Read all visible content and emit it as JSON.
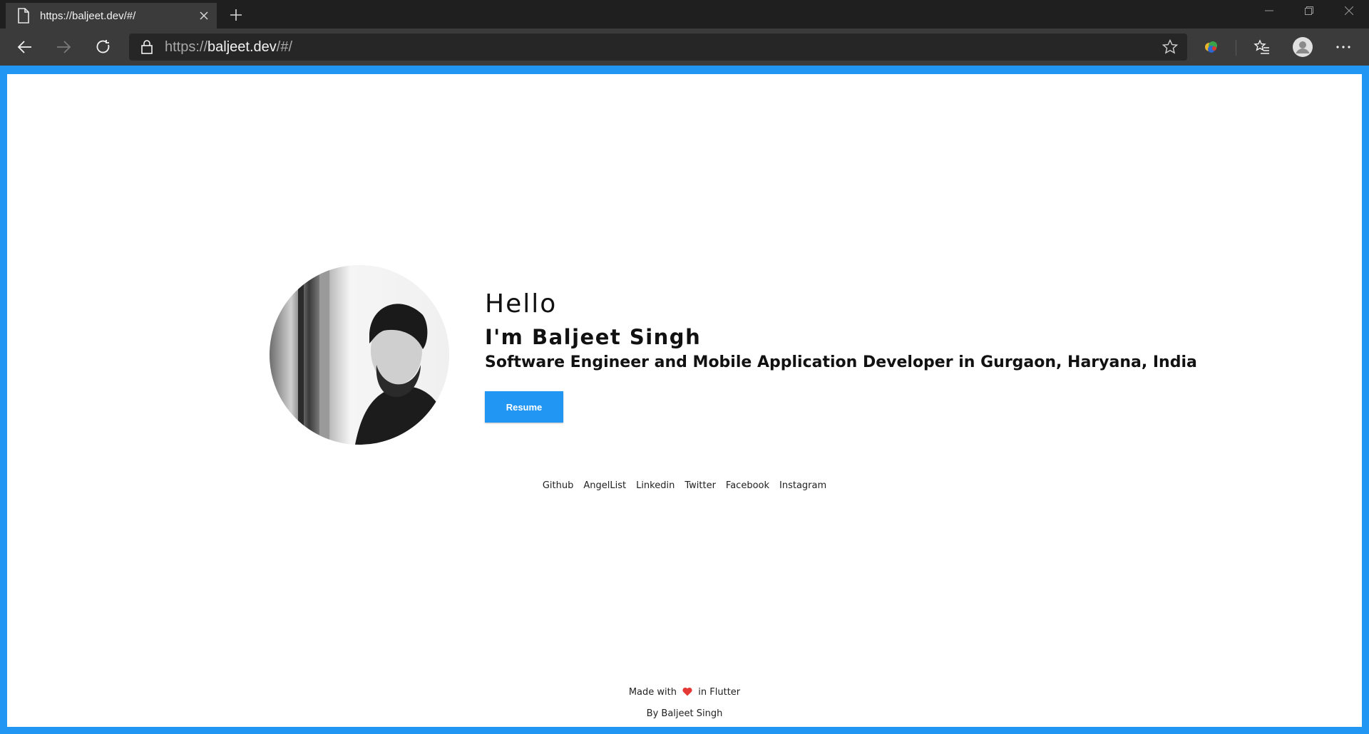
{
  "browser": {
    "tab": {
      "title": "https://baljeet.dev/#/",
      "icon": "page-icon"
    },
    "address": {
      "scheme": "https://",
      "host": "baljeet.dev",
      "path": "/#/"
    },
    "icons": [
      "back-arrow-icon",
      "forward-arrow-icon",
      "refresh-icon",
      "lock-icon",
      "star-icon",
      "extension-icon",
      "favorites-icon",
      "profile-icon",
      "more-icon"
    ]
  },
  "hero": {
    "greeting": "Hello",
    "name": "I'm Baljeet Singh",
    "tagline": "Software Engineer and Mobile Application Developer in Gurgaon, Haryana, India",
    "resume_label": "Resume"
  },
  "social": {
    "links": [
      "Github",
      "AngelList",
      "Linkedin",
      "Twitter",
      "Facebook",
      "Instagram"
    ]
  },
  "footer": {
    "made_prefix": "Made with",
    "made_suffix": "in Flutter",
    "by": "By Baljeet Singh"
  },
  "colors": {
    "accent": "#2196f3",
    "heart": "#e53935",
    "chrome_dark": "#1f1f1f",
    "chrome": "#3b3b3b"
  }
}
